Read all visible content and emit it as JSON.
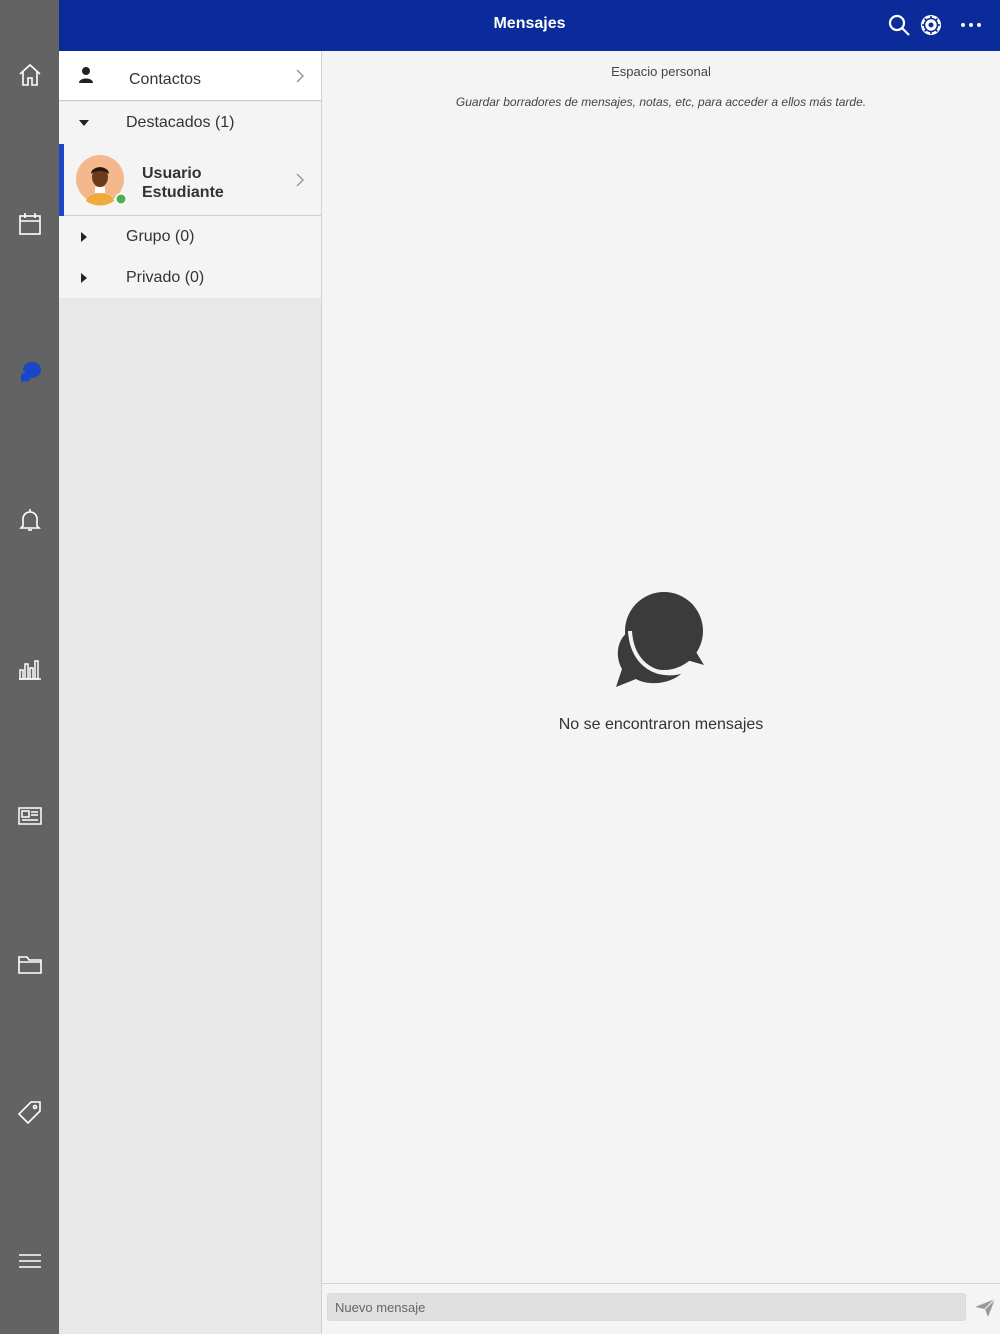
{
  "header": {
    "title": "Mensajes"
  },
  "rail": {
    "items": [
      {
        "icon": "home-icon"
      },
      {
        "icon": "calendar-icon"
      },
      {
        "icon": "messages-icon",
        "active": true
      },
      {
        "icon": "bell-icon"
      },
      {
        "icon": "bar-chart-icon"
      },
      {
        "icon": "newspaper-icon"
      },
      {
        "icon": "folder-icon"
      },
      {
        "icon": "tag-icon"
      },
      {
        "icon": "hamburger-menu-icon"
      }
    ]
  },
  "panel": {
    "contacts_label": "Contactos",
    "starred_label": "Destacados (1)",
    "group_label": "Grupo (0)",
    "private_label": "Privado (0)",
    "user": {
      "line1": "Usuario",
      "line2": "Estudiante",
      "status": "online"
    }
  },
  "main": {
    "space_title": "Espacio personal",
    "space_subtitle": "Guardar borradores de mensajes, notas, etc, para acceder a ellos más tarde.",
    "empty_text": "No se encontraron mensajes",
    "compose_placeholder": "Nuevo mensaje"
  },
  "colors": {
    "header_bg": "#0a2b99",
    "rail_bg": "#636363",
    "active_icon": "#1a47c8",
    "online_dot": "#4caf50"
  }
}
